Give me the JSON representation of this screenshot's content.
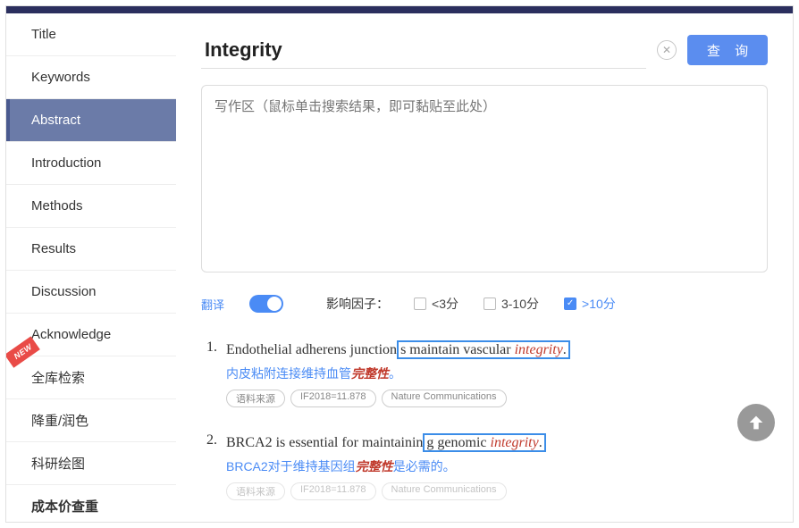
{
  "sidebar": {
    "items": [
      {
        "label": "Title"
      },
      {
        "label": "Keywords"
      },
      {
        "label": "Abstract"
      },
      {
        "label": "Introduction"
      },
      {
        "label": "Methods"
      },
      {
        "label": "Results"
      },
      {
        "label": "Discussion"
      },
      {
        "label": "Acknowledge"
      },
      {
        "label": "全库检索"
      },
      {
        "label": "降重/润色"
      },
      {
        "label": "科研绘图"
      },
      {
        "label": "成本价查重"
      }
    ],
    "new_badge": "NEW"
  },
  "search": {
    "value": "Integrity",
    "query_label": "查 询"
  },
  "writing_area": {
    "placeholder": "写作区（鼠标单击搜索结果，即可黏贴至此处）"
  },
  "filters": {
    "translate_label": "翻译",
    "factor_label": "影响因子：",
    "options": [
      {
        "label": "<3分"
      },
      {
        "label": "3-10分"
      },
      {
        "label": ">10分"
      }
    ]
  },
  "results": [
    {
      "num": "1.",
      "pre": "Endothelial adherens junction",
      "hl_pre": "s maintain vascular ",
      "kw": "integrity",
      "hl_post": ".",
      "post": "",
      "trans_pre": "内皮粘附连接维持血管",
      "trans_kw": "完整性",
      "trans_post": "。",
      "tags": [
        "语料来源",
        "IF2018=11.878",
        "Nature Communications"
      ]
    },
    {
      "num": "2.",
      "pre": "BRCA2 is essential for maintainin",
      "hl_pre": "g genomic ",
      "kw": "integrity",
      "hl_post": ".",
      "post": "",
      "trans_pre": "BRCA2对于维持基因组",
      "trans_kw": "完整性",
      "trans_post": "是必需的。",
      "tags": [
        "语料来源",
        "IF2018=11.878",
        "Nature Communications"
      ]
    }
  ]
}
